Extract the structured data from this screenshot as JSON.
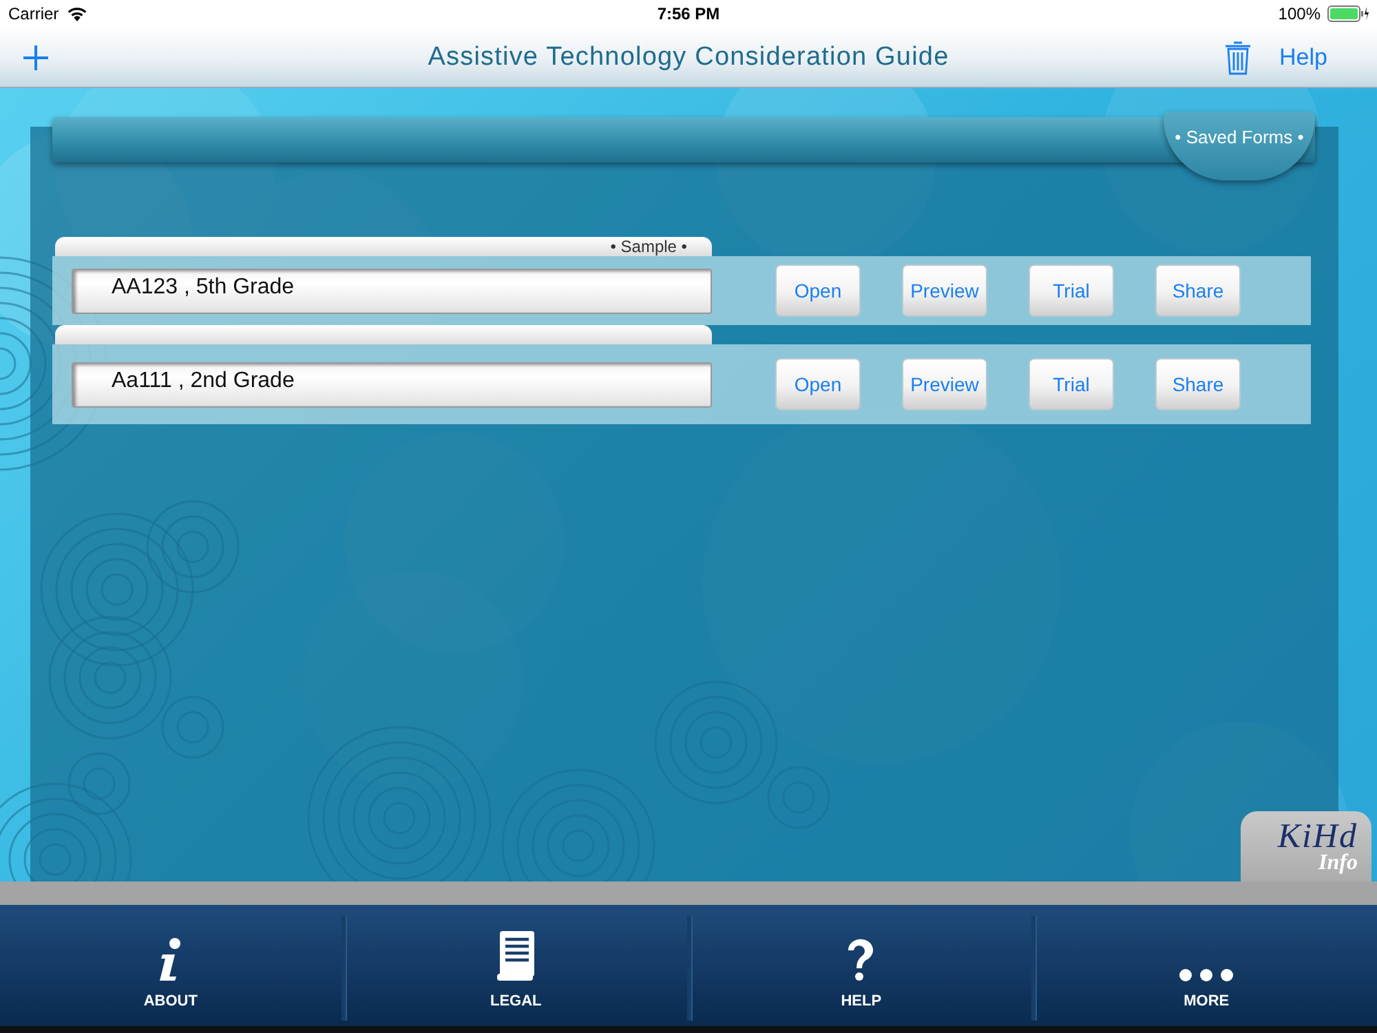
{
  "status_bar": {
    "carrier": "Carrier",
    "time": "7:56 PM",
    "battery": "100%"
  },
  "nav_bar": {
    "title": "Assistive Technology Consideration Guide",
    "help": "Help"
  },
  "panel": {
    "tab_label": "• Saved Forms •"
  },
  "forms": [
    {
      "tab_label": "• Sample •",
      "name": "AA123 , 5th Grade",
      "buttons": [
        "Open",
        "Preview",
        "Trial",
        "Share"
      ]
    },
    {
      "name": "Aa111 , 2nd Grade",
      "buttons": [
        "Open",
        "Preview",
        "Trial",
        "Share"
      ]
    }
  ],
  "logo": {
    "main": "KiHd",
    "sub": "Info"
  },
  "tab_bar": [
    {
      "kind": "info",
      "label": "ABOUT"
    },
    {
      "kind": "document",
      "label": "LEGAL"
    },
    {
      "kind": "question",
      "label": "HELP"
    },
    {
      "kind": "more",
      "label": "MORE"
    }
  ]
}
